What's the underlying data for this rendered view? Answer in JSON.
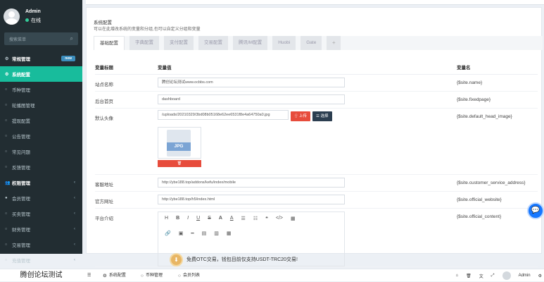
{
  "sidebar": {
    "user": {
      "name": "Admin",
      "status": "在线"
    },
    "search_placeholder": "搜索菜单",
    "items": [
      {
        "label": "常规管理",
        "icon": "cogs-icon",
        "glyph": "⚙",
        "badge": "new",
        "kind": "bold"
      },
      {
        "label": "系统配置",
        "icon": "gear-icon",
        "glyph": "⚙",
        "kind": "active"
      },
      {
        "label": "币种管理",
        "icon": "circle-icon",
        "glyph": "○",
        "kind": "sub"
      },
      {
        "label": "轮播图管理",
        "icon": "circle-icon",
        "glyph": "○",
        "kind": "sub"
      },
      {
        "label": "提现配置",
        "icon": "circle-icon",
        "glyph": "○",
        "kind": "sub"
      },
      {
        "label": "公告管理",
        "icon": "circle-icon",
        "glyph": "○",
        "kind": "sub"
      },
      {
        "label": "常见问题",
        "icon": "circle-icon",
        "glyph": "○",
        "kind": "sub"
      },
      {
        "label": "反馈管理",
        "icon": "circle-icon",
        "glyph": "○",
        "kind": "sub"
      },
      {
        "label": "权限管理",
        "icon": "users-icon",
        "glyph": "👥",
        "kind": "bold",
        "arrow": "‹"
      },
      {
        "label": "会员管理",
        "icon": "user-icon",
        "glyph": "●",
        "kind": "sub",
        "arrow": "‹"
      },
      {
        "label": "买卖管理",
        "icon": "circle-icon",
        "glyph": "○",
        "kind": "sub",
        "arrow": "‹"
      },
      {
        "label": "财务管理",
        "icon": "circle-icon",
        "glyph": "○",
        "kind": "sub",
        "arrow": "‹"
      },
      {
        "label": "交易管理",
        "icon": "circle-icon",
        "glyph": "○",
        "kind": "sub",
        "arrow": "‹"
      },
      {
        "label": "充值管理",
        "icon": "circle-icon",
        "glyph": "○",
        "kind": "sub",
        "arrow": "‹"
      }
    ]
  },
  "panel": {
    "title": "系统配置",
    "description": "可以在此增改系统的变量和分组,也可以自定义分组和变量",
    "tabs": [
      "基础配置",
      "字典配置",
      "支付配置",
      "交易配置",
      "腾讯IM配置",
      "Huobi",
      "Gate",
      "+"
    ]
  },
  "table": {
    "headers": [
      "变量标题",
      "变量值",
      "变量名"
    ],
    "rows": [
      {
        "title": "站点名称",
        "value": "腾创论坛测试www.ocbbs.com",
        "name": "{$site.name}"
      },
      {
        "title": "后台首页",
        "value": "dashboard",
        "name": "{$site.fixedpage}"
      },
      {
        "title": "默认头像",
        "value": "/uploads/20210329/3bd08b05168e62ee6531f8e4a64750a0.jpg",
        "name": "{$site.default_head_image}"
      },
      {
        "title": "客服地址",
        "value": "http://ybe188.top/addons/kefu/index/mobile",
        "name": "{$site.customer_service_address}"
      },
      {
        "title": "官方网址",
        "value": "http://ybe188.top/h5/index.html",
        "name": "{$site.official_website}"
      },
      {
        "title": "平台介绍",
        "value": "",
        "name": "{$site.official_content}"
      }
    ],
    "upload_label": "上传",
    "select_label": "选择",
    "jpg_label": "JPG",
    "delete_label": "🗑"
  },
  "editor": {
    "toolbar1": [
      "H",
      "B",
      "I",
      "U",
      "S",
      "A",
      "A",
      "☰",
      "☷",
      "❝",
      "</>",
      "▦"
    ],
    "toolbar2": [
      "🔗",
      "▣",
      "━",
      "▤",
      "▥",
      "▦"
    ],
    "content": "免费OTC交易，钱包目前仅支持USDT-TRC20交易!"
  },
  "bottombar": {
    "logo": "腾创论坛测试",
    "tabs": [
      {
        "label": "系统配置",
        "glyph": "⚙"
      },
      {
        "label": "币种管理",
        "glyph": "○"
      },
      {
        "label": "会员列表",
        "glyph": "○"
      }
    ],
    "admin": "Admin"
  },
  "colors": {
    "accent": "#18bc9c",
    "sidebar": "#222d32",
    "danger": "#e74c3c",
    "navy": "#2c3e50"
  }
}
